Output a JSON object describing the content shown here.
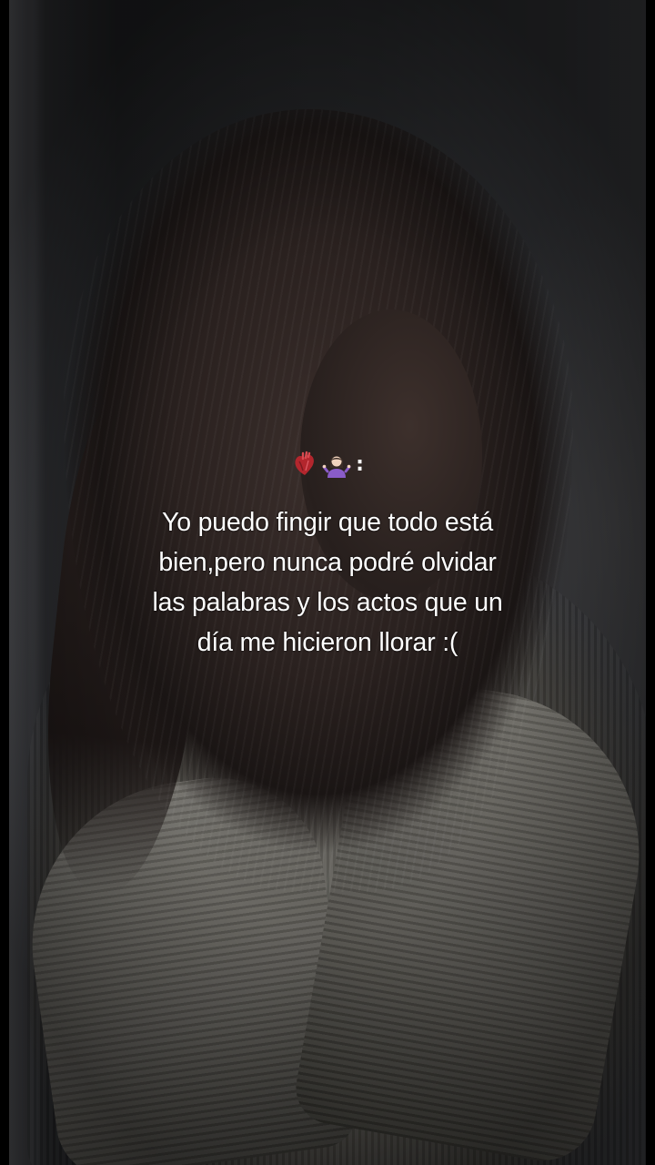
{
  "overlay": {
    "emojis": [
      "anatomical-heart",
      "woman-shrugging"
    ],
    "emoji_suffix": ":",
    "caption_lines": [
      "Yo puedo fingir que todo está",
      "bien,pero nunca podré olvidar",
      "las palabras y los actos que un",
      "día me hicieron llorar :("
    ]
  }
}
